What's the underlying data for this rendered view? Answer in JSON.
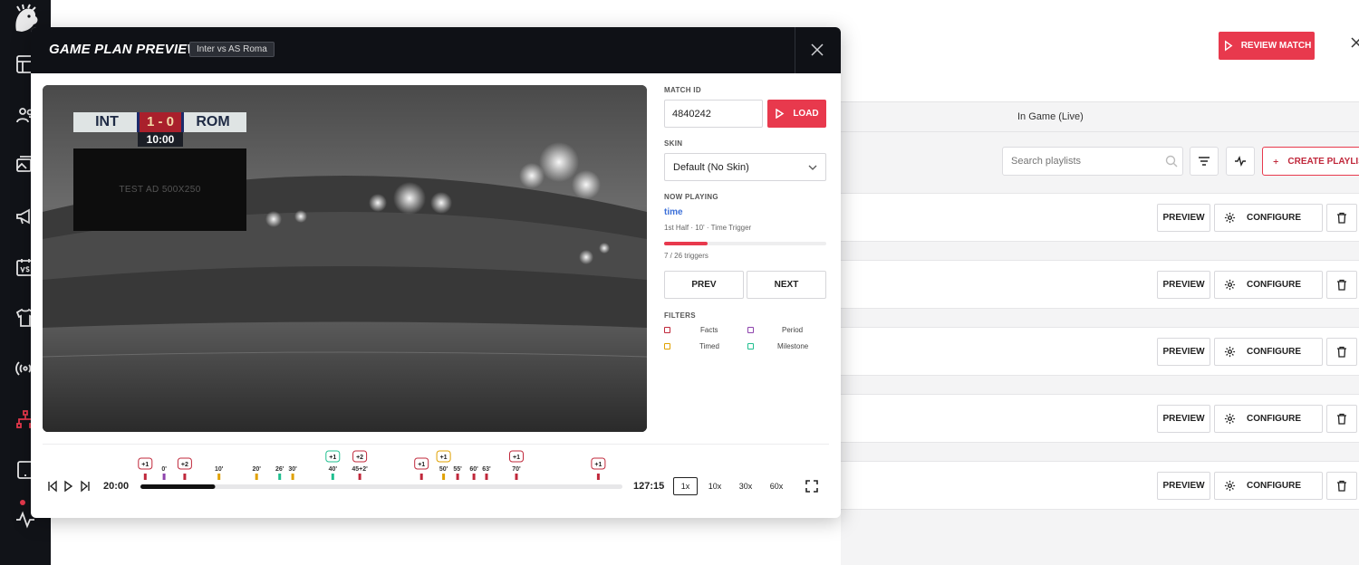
{
  "background": {
    "review_button": "REVIEW MATCH",
    "tab_label": "In Game (Live)",
    "search_placeholder": "Search playlists",
    "create_button": "CREATE PLAYLIST",
    "rows": [
      {
        "preview": "PREVIEW",
        "configure": "CONFIGURE"
      },
      {
        "preview": "PREVIEW",
        "configure": "CONFIGURE"
      },
      {
        "preview": "PREVIEW",
        "configure": "CONFIGURE"
      },
      {
        "preview": "PREVIEW",
        "configure": "CONFIGURE"
      },
      {
        "preview": "PREVIEW",
        "configure": "CONFIGURE"
      }
    ]
  },
  "modal": {
    "title": "GAME PLAN PREVIEW",
    "badge": "Inter vs AS Roma",
    "video": {
      "home_team": "INT",
      "away_team": "ROM",
      "score": "1 - 0",
      "clock": "10:00",
      "ad_text": "TEST AD 500X250"
    },
    "panel": {
      "match_id_label": "MATCH ID",
      "match_id_value": "4840242",
      "load_button": "LOAD",
      "skin_label": "SKIN",
      "skin_value": "Default (No Skin)",
      "now_playing_label": "NOW PLAYING",
      "now_playing_name": "time",
      "now_playing_meta": "1st Half · 10' · Time Trigger",
      "progress": 0.27,
      "trigger_count": "7 / 26 triggers",
      "prev_button": "PREV",
      "next_button": "NEXT",
      "filters_label": "FILTERS",
      "filters": [
        {
          "label": "Facts",
          "color": "#c0283b"
        },
        {
          "label": "Period",
          "color": "#8e44ad"
        },
        {
          "label": "Timed",
          "color": "#e0a100"
        },
        {
          "label": "Milestone",
          "color": "#1fbf8f"
        }
      ]
    },
    "timeline": {
      "start_time": "20:00",
      "end_time": "127:15",
      "progress": 0.155,
      "speeds": [
        "1x",
        "10x",
        "30x",
        "60x"
      ],
      "active_speed": 0,
      "markers": [
        {
          "pos": 0.01,
          "label": "",
          "badge": "+1",
          "type": "facts"
        },
        {
          "pos": 0.049,
          "label": "0'",
          "badge": "",
          "type": "period"
        },
        {
          "pos": 0.092,
          "label": "",
          "badge": "+2",
          "type": "facts"
        },
        {
          "pos": 0.163,
          "label": "10'",
          "badge": "",
          "type": "timed"
        },
        {
          "pos": 0.241,
          "label": "20'",
          "badge": "",
          "type": "timed"
        },
        {
          "pos": 0.289,
          "label": "26'",
          "badge": "",
          "type": "milestone"
        },
        {
          "pos": 0.316,
          "label": "30'",
          "badge": "",
          "type": "timed"
        },
        {
          "pos": 0.399,
          "label": "40'",
          "badge": "+1",
          "type": "milestone"
        },
        {
          "pos": 0.455,
          "label": "45+2'",
          "badge": "+2",
          "type": "facts"
        },
        {
          "pos": 0.583,
          "label": "",
          "badge": "+1",
          "type": "facts"
        },
        {
          "pos": 0.629,
          "label": "50'",
          "badge": "+1",
          "type": "timed"
        },
        {
          "pos": 0.658,
          "label": "55'",
          "badge": "",
          "type": "facts"
        },
        {
          "pos": 0.692,
          "label": "60'",
          "badge": "",
          "type": "facts"
        },
        {
          "pos": 0.718,
          "label": "63'",
          "badge": "",
          "type": "facts"
        },
        {
          "pos": 0.78,
          "label": "70'",
          "badge": "+1",
          "type": "facts"
        },
        {
          "pos": 0.95,
          "label": "",
          "badge": "+1",
          "type": "facts"
        }
      ],
      "colors": {
        "facts": "#c0283b",
        "period": "#8e44ad",
        "timed": "#e0a100",
        "milestone": "#1fbf8f"
      }
    }
  }
}
